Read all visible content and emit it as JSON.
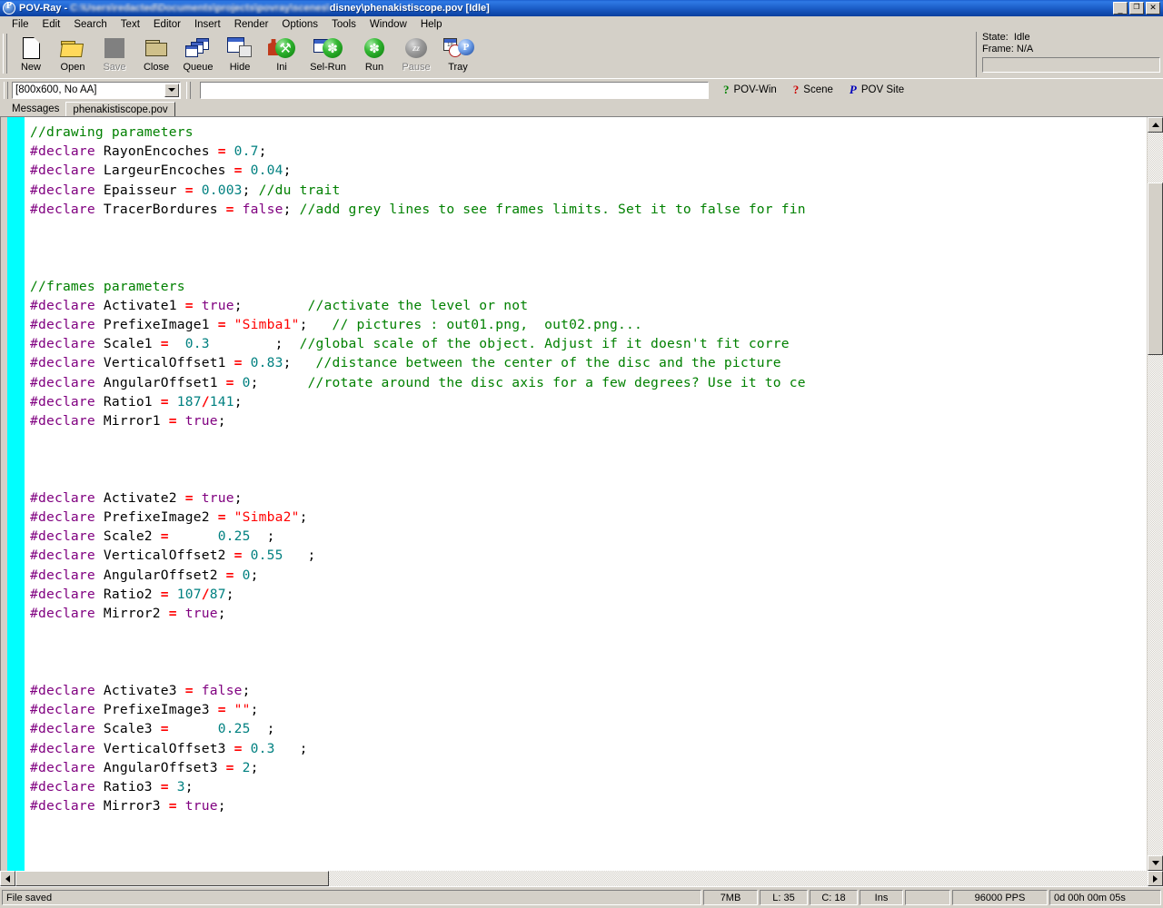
{
  "window": {
    "app_name": "POV-Ray",
    "title_prefix": "POV-Ray - ",
    "title_redacted": "C:\\Users\\redacted\\Documents\\projects\\povray\\scenes\\",
    "title_suffix": "disney\\phenakistiscope.pov [Idle]",
    "minimize_glyph": "_",
    "restore_glyph": "❐",
    "close_glyph": "×",
    "icon_name": "povray-logo-icon"
  },
  "menu": {
    "items": [
      {
        "label": "File"
      },
      {
        "label": "Edit"
      },
      {
        "label": "Search"
      },
      {
        "label": "Text"
      },
      {
        "label": "Editor"
      },
      {
        "label": "Insert"
      },
      {
        "label": "Render"
      },
      {
        "label": "Options"
      },
      {
        "label": "Tools"
      },
      {
        "label": "Window"
      },
      {
        "label": "Help"
      }
    ]
  },
  "toolbar": {
    "buttons": [
      {
        "label": "New",
        "icon": "new-page-icon",
        "enabled": true
      },
      {
        "label": "Open",
        "icon": "open-folder-icon",
        "enabled": true
      },
      {
        "label": "Save",
        "icon": "save-icon",
        "enabled": false
      },
      {
        "label": "Close",
        "icon": "close-folder-icon",
        "enabled": true
      },
      {
        "label": "Queue",
        "icon": "queue-stack-icon",
        "enabled": true
      },
      {
        "label": "Hide",
        "icon": "hide-window-icon",
        "enabled": true
      },
      {
        "label": "Ini",
        "icon": "ini-wrench-icon",
        "enabled": true
      },
      {
        "label": "Sel-Run",
        "icon": "sel-run-icon",
        "enabled": true
      },
      {
        "label": "Run",
        "icon": "run-icon",
        "enabled": true
      },
      {
        "label": "Pause",
        "icon": "pause-zzz-icon",
        "enabled": false
      },
      {
        "label": "Tray",
        "icon": "tray-icon",
        "enabled": true
      }
    ]
  },
  "state_panel": {
    "state_label": "State:",
    "state_value": "Idle",
    "frame_label": "Frame:",
    "frame_value": "N/A",
    "state_line": "State:  Idle",
    "frame_line": "Frame: N/A",
    "progress_percent": 0
  },
  "render_options": {
    "selected": "[800x600, No AA]",
    "options": [
      "[800x600, No AA]"
    ]
  },
  "command_line": {
    "value": "",
    "placeholder": ""
  },
  "help_links": [
    {
      "label": "POV-Win",
      "glyph": "?",
      "color": "#008000",
      "icon": "help-question-green-icon"
    },
    {
      "label": "Scene",
      "glyph": "?",
      "color": "#cc0000",
      "icon": "help-question-red-icon"
    },
    {
      "label": "POV Site",
      "glyph": "P",
      "color": "#0000bb",
      "icon": "povray-p-blue-icon"
    }
  ],
  "tabs": [
    {
      "label": "Messages",
      "active": false
    },
    {
      "label": "phenakistiscope.pov",
      "active": true
    }
  ],
  "editor": {
    "gutter_color": "#00ffff",
    "background": "#ffffff",
    "colors": {
      "keyword": "#800080",
      "identifier": "#000000",
      "operator": "#ff0000",
      "number": "#008080",
      "string": "#ff0000",
      "comment": "#008000"
    },
    "lines": [
      {
        "tokens": [
          {
            "t": "//drawing parameters",
            "c": "c"
          }
        ]
      },
      {
        "tokens": [
          {
            "t": "#declare",
            "c": "k"
          },
          {
            "t": " RayonEncoches ",
            "c": "id"
          },
          {
            "t": "=",
            "c": "op"
          },
          {
            "t": " 0.7",
            "c": "n"
          },
          {
            "t": ";",
            "c": "pn"
          }
        ]
      },
      {
        "tokens": [
          {
            "t": "#declare",
            "c": "k"
          },
          {
            "t": " LargeurEncoches ",
            "c": "id"
          },
          {
            "t": "=",
            "c": "op"
          },
          {
            "t": " 0.04",
            "c": "n"
          },
          {
            "t": ";",
            "c": "pn"
          }
        ]
      },
      {
        "tokens": [
          {
            "t": "#declare",
            "c": "k"
          },
          {
            "t": " Epaisseur ",
            "c": "id"
          },
          {
            "t": "=",
            "c": "op"
          },
          {
            "t": " 0.003",
            "c": "n"
          },
          {
            "t": "; ",
            "c": "pn"
          },
          {
            "t": "//du trait",
            "c": "c"
          }
        ]
      },
      {
        "tokens": [
          {
            "t": "#declare",
            "c": "k"
          },
          {
            "t": " TracerBordures ",
            "c": "id"
          },
          {
            "t": "=",
            "c": "op"
          },
          {
            "t": " false",
            "c": "k"
          },
          {
            "t": "; ",
            "c": "pn"
          },
          {
            "t": "//add grey lines to see frames limits. Set it to false for fin",
            "c": "c"
          }
        ]
      },
      {
        "tokens": []
      },
      {
        "tokens": []
      },
      {
        "tokens": []
      },
      {
        "tokens": [
          {
            "t": "//frames parameters",
            "c": "c"
          }
        ]
      },
      {
        "tokens": [
          {
            "t": "#declare",
            "c": "k"
          },
          {
            "t": " Activate1 ",
            "c": "id"
          },
          {
            "t": "=",
            "c": "op"
          },
          {
            "t": " true",
            "c": "k"
          },
          {
            "t": ";        ",
            "c": "pn"
          },
          {
            "t": "//activate the level or not",
            "c": "c"
          }
        ]
      },
      {
        "tokens": [
          {
            "t": "#declare",
            "c": "k"
          },
          {
            "t": " PrefixeImage1 ",
            "c": "id"
          },
          {
            "t": "=",
            "c": "op"
          },
          {
            "t": " \"Simba1\"",
            "c": "s"
          },
          {
            "t": ";   ",
            "c": "pn"
          },
          {
            "t": "// pictures : out01.png,  out02.png...",
            "c": "c"
          }
        ]
      },
      {
        "tokens": [
          {
            "t": "#declare",
            "c": "k"
          },
          {
            "t": " Scale1 ",
            "c": "id"
          },
          {
            "t": "=",
            "c": "op"
          },
          {
            "t": "  0.3",
            "c": "n"
          },
          {
            "t": "        ;  ",
            "c": "pn"
          },
          {
            "t": "//global scale of the object. Adjust if it doesn't fit corre",
            "c": "c"
          }
        ]
      },
      {
        "tokens": [
          {
            "t": "#declare",
            "c": "k"
          },
          {
            "t": " VerticalOffset1 ",
            "c": "id"
          },
          {
            "t": "=",
            "c": "op"
          },
          {
            "t": " 0.83",
            "c": "n"
          },
          {
            "t": ";   ",
            "c": "pn"
          },
          {
            "t": "//distance between the center of the disc and the picture",
            "c": "c"
          }
        ]
      },
      {
        "tokens": [
          {
            "t": "#declare",
            "c": "k"
          },
          {
            "t": " AngularOffset1 ",
            "c": "id"
          },
          {
            "t": "=",
            "c": "op"
          },
          {
            "t": " 0",
            "c": "n"
          },
          {
            "t": ";      ",
            "c": "pn"
          },
          {
            "t": "//rotate around the disc axis for a few degrees? Use it to ce",
            "c": "c"
          }
        ]
      },
      {
        "tokens": [
          {
            "t": "#declare",
            "c": "k"
          },
          {
            "t": " Ratio1 ",
            "c": "id"
          },
          {
            "t": "=",
            "c": "op"
          },
          {
            "t": " 187",
            "c": "n"
          },
          {
            "t": "/",
            "c": "op"
          },
          {
            "t": "141",
            "c": "n"
          },
          {
            "t": ";",
            "c": "pn"
          }
        ]
      },
      {
        "tokens": [
          {
            "t": "#declare",
            "c": "k"
          },
          {
            "t": " Mirror1 ",
            "c": "id"
          },
          {
            "t": "=",
            "c": "op"
          },
          {
            "t": " true",
            "c": "k"
          },
          {
            "t": ";",
            "c": "pn"
          }
        ]
      },
      {
        "tokens": []
      },
      {
        "tokens": []
      },
      {
        "tokens": []
      },
      {
        "tokens": [
          {
            "t": "#declare",
            "c": "k"
          },
          {
            "t": " Activate2 ",
            "c": "id"
          },
          {
            "t": "=",
            "c": "op"
          },
          {
            "t": " true",
            "c": "k"
          },
          {
            "t": ";",
            "c": "pn"
          }
        ]
      },
      {
        "tokens": [
          {
            "t": "#declare",
            "c": "k"
          },
          {
            "t": " PrefixeImage2 ",
            "c": "id"
          },
          {
            "t": "=",
            "c": "op"
          },
          {
            "t": " \"Simba2\"",
            "c": "s"
          },
          {
            "t": ";",
            "c": "pn"
          }
        ]
      },
      {
        "tokens": [
          {
            "t": "#declare",
            "c": "k"
          },
          {
            "t": " Scale2 ",
            "c": "id"
          },
          {
            "t": "=",
            "c": "op"
          },
          {
            "t": "      0.25",
            "c": "n"
          },
          {
            "t": "  ;",
            "c": "pn"
          }
        ]
      },
      {
        "tokens": [
          {
            "t": "#declare",
            "c": "k"
          },
          {
            "t": " VerticalOffset2 ",
            "c": "id"
          },
          {
            "t": "=",
            "c": "op"
          },
          {
            "t": " 0.55",
            "c": "n"
          },
          {
            "t": "   ;",
            "c": "pn"
          }
        ]
      },
      {
        "tokens": [
          {
            "t": "#declare",
            "c": "k"
          },
          {
            "t": " AngularOffset2 ",
            "c": "id"
          },
          {
            "t": "=",
            "c": "op"
          },
          {
            "t": " 0",
            "c": "n"
          },
          {
            "t": ";",
            "c": "pn"
          }
        ]
      },
      {
        "tokens": [
          {
            "t": "#declare",
            "c": "k"
          },
          {
            "t": " Ratio2 ",
            "c": "id"
          },
          {
            "t": "=",
            "c": "op"
          },
          {
            "t": " 107",
            "c": "n"
          },
          {
            "t": "/",
            "c": "op"
          },
          {
            "t": "87",
            "c": "n"
          },
          {
            "t": ";",
            "c": "pn"
          }
        ]
      },
      {
        "tokens": [
          {
            "t": "#declare",
            "c": "k"
          },
          {
            "t": " Mirror2 ",
            "c": "id"
          },
          {
            "t": "=",
            "c": "op"
          },
          {
            "t": " true",
            "c": "k"
          },
          {
            "t": ";",
            "c": "pn"
          }
        ]
      },
      {
        "tokens": []
      },
      {
        "tokens": []
      },
      {
        "tokens": []
      },
      {
        "tokens": [
          {
            "t": "#declare",
            "c": "k"
          },
          {
            "t": " Activate3 ",
            "c": "id"
          },
          {
            "t": "=",
            "c": "op"
          },
          {
            "t": " false",
            "c": "k"
          },
          {
            "t": ";",
            "c": "pn"
          }
        ]
      },
      {
        "tokens": [
          {
            "t": "#declare",
            "c": "k"
          },
          {
            "t": " PrefixeImage3 ",
            "c": "id"
          },
          {
            "t": "=",
            "c": "op"
          },
          {
            "t": " \"\"",
            "c": "s"
          },
          {
            "t": ";",
            "c": "pn"
          }
        ]
      },
      {
        "tokens": [
          {
            "t": "#declare",
            "c": "k"
          },
          {
            "t": " Scale3 ",
            "c": "id"
          },
          {
            "t": "=",
            "c": "op"
          },
          {
            "t": "      0.25",
            "c": "n"
          },
          {
            "t": "  ;",
            "c": "pn"
          }
        ]
      },
      {
        "tokens": [
          {
            "t": "#declare",
            "c": "k"
          },
          {
            "t": " VerticalOffset3 ",
            "c": "id"
          },
          {
            "t": "=",
            "c": "op"
          },
          {
            "t": " 0.3",
            "c": "n"
          },
          {
            "t": "   ;",
            "c": "pn"
          }
        ]
      },
      {
        "tokens": [
          {
            "t": "#declare",
            "c": "k"
          },
          {
            "t": " AngularOffset3 ",
            "c": "id"
          },
          {
            "t": "=",
            "c": "op"
          },
          {
            "t": " 2",
            "c": "n"
          },
          {
            "t": ";",
            "c": "pn"
          }
        ]
      },
      {
        "tokens": [
          {
            "t": "#declare",
            "c": "k"
          },
          {
            "t": " Ratio3 ",
            "c": "id"
          },
          {
            "t": "=",
            "c": "op"
          },
          {
            "t": " 3",
            "c": "n"
          },
          {
            "t": ";",
            "c": "pn"
          }
        ]
      },
      {
        "tokens": [
          {
            "t": "#declare",
            "c": "k"
          },
          {
            "t": " Mirror3 ",
            "c": "id"
          },
          {
            "t": "=",
            "c": "op"
          },
          {
            "t": " true",
            "c": "k"
          },
          {
            "t": ";",
            "c": "pn"
          }
        ]
      },
      {
        "tokens": []
      },
      {
        "tokens": []
      },
      {
        "tokens": []
      },
      {
        "tokens": []
      }
    ]
  },
  "statusbar": {
    "message": "File saved",
    "cells": [
      {
        "text": "7MB"
      },
      {
        "text": "L: 35"
      },
      {
        "text": "C: 18"
      },
      {
        "text": "Ins"
      },
      {
        "text": ""
      },
      {
        "text": "96000 PPS"
      },
      {
        "text": "0d 00h 00m 05s"
      }
    ]
  }
}
